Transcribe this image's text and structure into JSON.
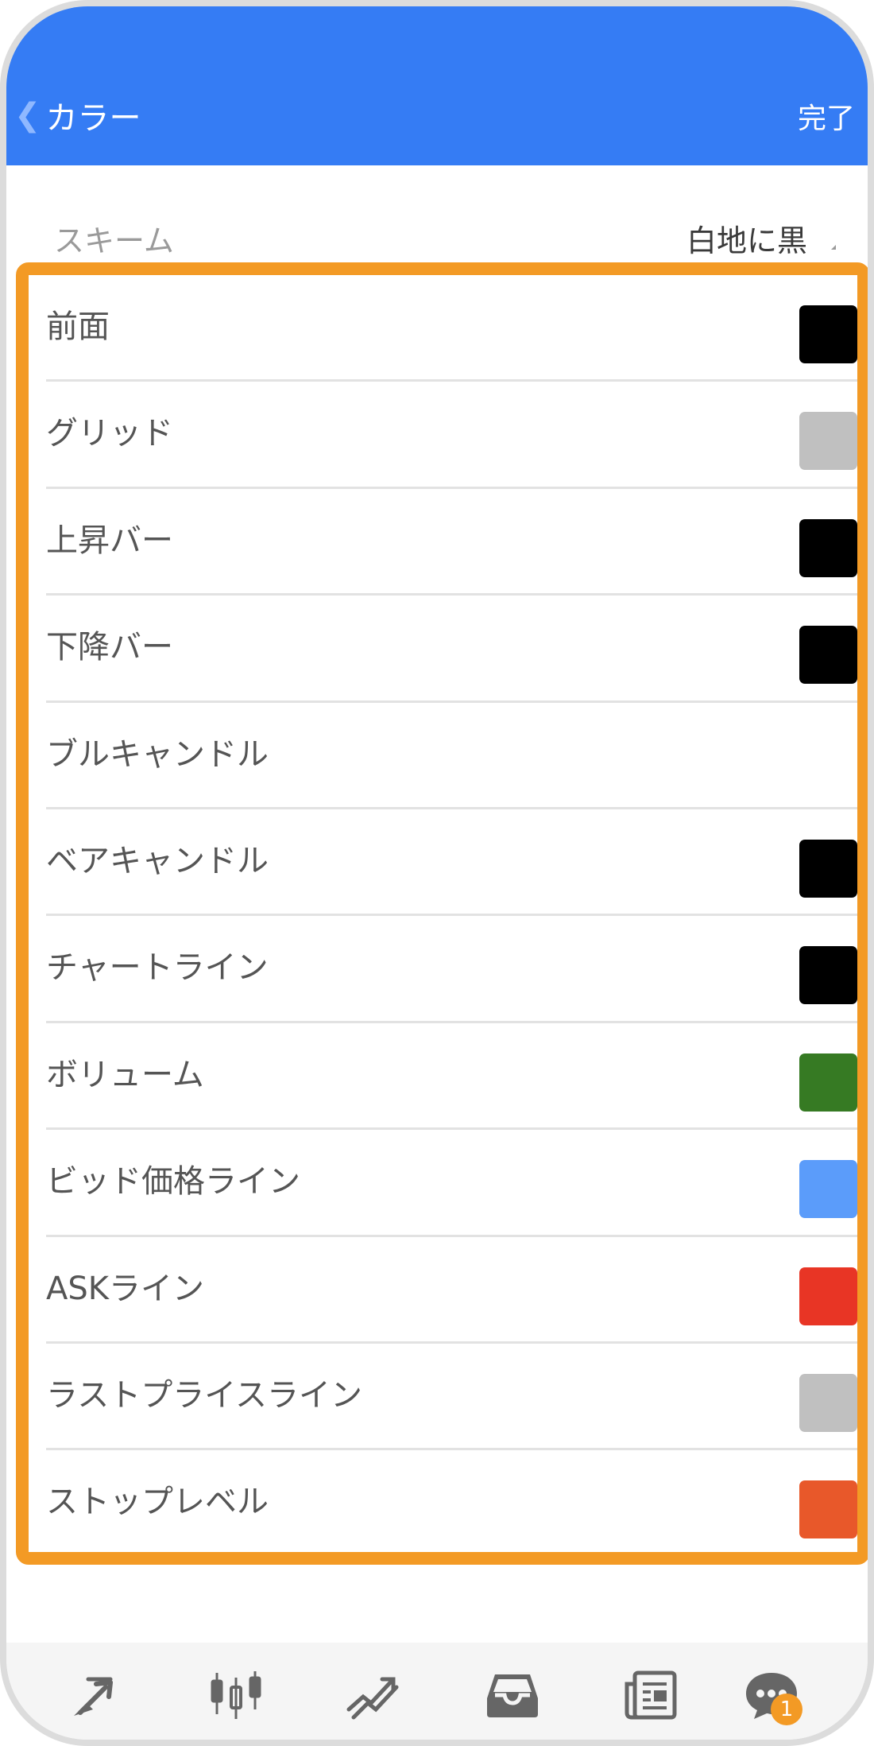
{
  "header": {
    "back_label": "カラー",
    "done_label": "完了"
  },
  "scheme": {
    "label": "スキーム",
    "value": "白地に黒"
  },
  "colors": [
    {
      "label": "前面",
      "color": "#000000"
    },
    {
      "label": "グリッド",
      "color": "#c0c0c0"
    },
    {
      "label": "上昇バー",
      "color": "#000000"
    },
    {
      "label": "下降バー",
      "color": "#000000"
    },
    {
      "label": "ブルキャンドル",
      "color": "#ffffff"
    },
    {
      "label": "ベアキャンドル",
      "color": "#000000"
    },
    {
      "label": "チャートライン",
      "color": "#000000"
    },
    {
      "label": "ボリューム",
      "color": "#367a23"
    },
    {
      "label": "ビッド価格ライン",
      "color": "#5b9cfa"
    },
    {
      "label": "ASKライン",
      "color": "#e83525"
    },
    {
      "label": "ラストプライスライン",
      "color": "#c0c0c0"
    },
    {
      "label": "ストップレベル",
      "color": "#e8582a"
    }
  ],
  "tabbar": {
    "icons": [
      "trade-icon",
      "chart-candles-icon",
      "history-icon",
      "inbox-icon",
      "news-icon",
      "chat-icon"
    ],
    "chat_badge": "1"
  },
  "theme": {
    "header_color": "#357cf4",
    "highlight_color": "#f39a25"
  }
}
